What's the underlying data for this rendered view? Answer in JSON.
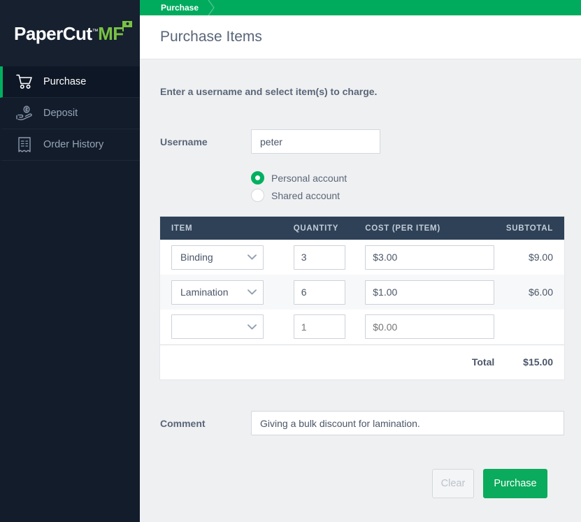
{
  "brand": {
    "name_primary": "PaperCut",
    "name_secondary": "MF",
    "trademark": "™",
    "accent_green": "#7ac143",
    "flag_icon": "flag-icon"
  },
  "sidebar": {
    "background": "#121c2b",
    "active_indicator_color": "#00b060",
    "items": [
      {
        "label": "Purchase",
        "icon": "shopping-cart-icon",
        "active": true
      },
      {
        "label": "Deposit",
        "icon": "hand-holding-dollar-icon",
        "active": false
      },
      {
        "label": "Order History",
        "icon": "receipt-icon",
        "active": false
      }
    ]
  },
  "header": {
    "breadcrumb": [
      "Purchase"
    ],
    "breadcrumb_separator_icon": "chevron-right-icon",
    "bar_color": "#00ab5e",
    "page_title": "Purchase Items"
  },
  "form": {
    "instruction": "Enter a username and select item(s) to charge.",
    "username": {
      "label": "Username",
      "value": "peter",
      "placeholder": ""
    },
    "account_type": {
      "options": [
        {
          "label": "Personal account",
          "selected": true
        },
        {
          "label": "Shared account",
          "selected": false
        }
      ]
    },
    "comment": {
      "label": "Comment",
      "value": "Giving a bulk discount for lamination.",
      "placeholder": ""
    }
  },
  "items_table": {
    "columns": [
      "ITEM",
      "QUANTITY",
      "COST (PER ITEM)",
      "SUBTOTAL"
    ],
    "header_background": "#2e4157",
    "rows": [
      {
        "item": "Binding",
        "item_placeholder": "",
        "quantity": "3",
        "quantity_placeholder": "",
        "cost": "$3.00",
        "cost_placeholder": "",
        "subtotal": "$9.00",
        "empty": false
      },
      {
        "item": "Lamination",
        "item_placeholder": "",
        "quantity": "6",
        "quantity_placeholder": "",
        "cost": "$1.00",
        "cost_placeholder": "",
        "subtotal": "$6.00",
        "empty": false
      },
      {
        "item": "",
        "item_placeholder": "",
        "quantity": "",
        "quantity_placeholder": "1",
        "cost": "",
        "cost_placeholder": "$0.00",
        "subtotal": "",
        "empty": true
      }
    ],
    "total_label": "Total",
    "total_value": "$15.00",
    "dropdown_icon": "chevron-down-icon"
  },
  "actions": {
    "clear_label": "Clear",
    "purchase_label": "Purchase",
    "purchase_color": "#0aab5c"
  }
}
